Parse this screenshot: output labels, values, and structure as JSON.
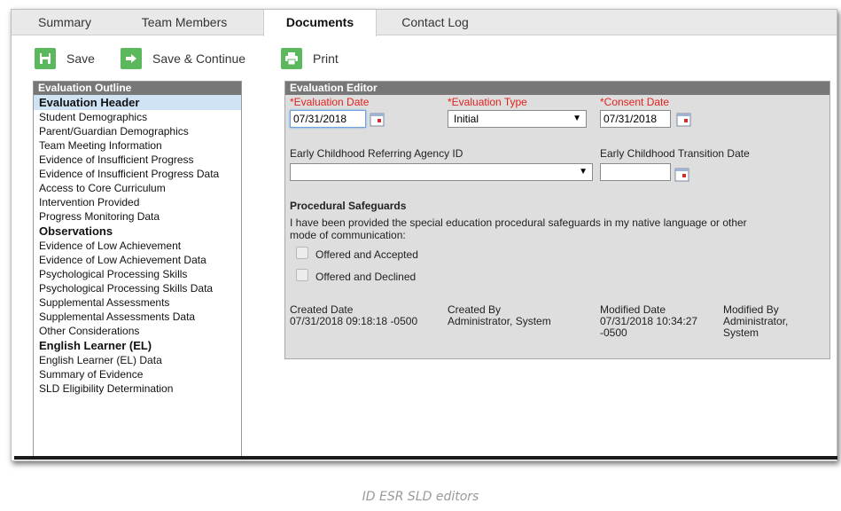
{
  "tabs": [
    {
      "label": "Summary"
    },
    {
      "label": "Team Members"
    },
    {
      "label": "Documents"
    },
    {
      "label": "Contact Log"
    }
  ],
  "toolbar": {
    "save_label": "Save",
    "save_continue_label": "Save & Continue",
    "print_label": "Print"
  },
  "outline": {
    "title": "Evaluation Outline",
    "items": [
      "Evaluation Header",
      "Student Demographics",
      "Parent/Guardian Demographics",
      "Team Meeting Information",
      "Evidence of Insufficient Progress",
      "Evidence of Insufficient Progress Data",
      "Access to Core Curriculum",
      "Intervention Provided",
      "Progress Monitoring Data",
      "Observations",
      "Evidence of Low Achievement",
      "Evidence of Low Achievement Data",
      "Psychological Processing Skills",
      "Psychological Processing Skills Data",
      "Supplemental Assessments",
      "Supplemental Assessments Data",
      "Other Considerations",
      "English Learner (EL)",
      "English Learner (EL) Data",
      "Summary of Evidence",
      "SLD Eligibility Determination"
    ]
  },
  "editor": {
    "title": "Evaluation Editor",
    "evaluation_date_label": "*Evaluation Date",
    "evaluation_date_value": "07/31/2018",
    "evaluation_type_label": "*Evaluation Type",
    "evaluation_type_value": "Initial",
    "consent_date_label": "*Consent Date",
    "consent_date_value": "07/31/2018",
    "referring_agency_label": "Early Childhood Referring Agency ID",
    "referring_agency_value": "",
    "transition_date_label": "Early Childhood Transition Date",
    "transition_date_value": "",
    "safeguards_heading": "Procedural Safeguards",
    "safeguards_text_1": "I have been provided the special education procedural safeguards in my native language or other",
    "safeguards_text_2": "mode of communication:",
    "offered_accepted_label": "Offered and Accepted",
    "offered_declined_label": "Offered and Declined",
    "created_date_label": "Created Date",
    "created_date_value": "07/31/2018 09:18:18 -0500",
    "created_by_label": "Created By",
    "created_by_value": "Administrator, System",
    "modified_date_label": "Modified Date",
    "modified_date_value_1": "07/31/2018 10:34:27",
    "modified_date_value_2": "-0500",
    "modified_by_label": "Modified By",
    "modified_by_value_1": "Administrator,",
    "modified_by_value_2": "System"
  },
  "caption": "ID ESR SLD editors",
  "colors": {
    "accent_green": "#5cb85c",
    "required_red": "#e0231d",
    "header_gray": "#777777",
    "selected_blue": "#cfe3f5"
  }
}
